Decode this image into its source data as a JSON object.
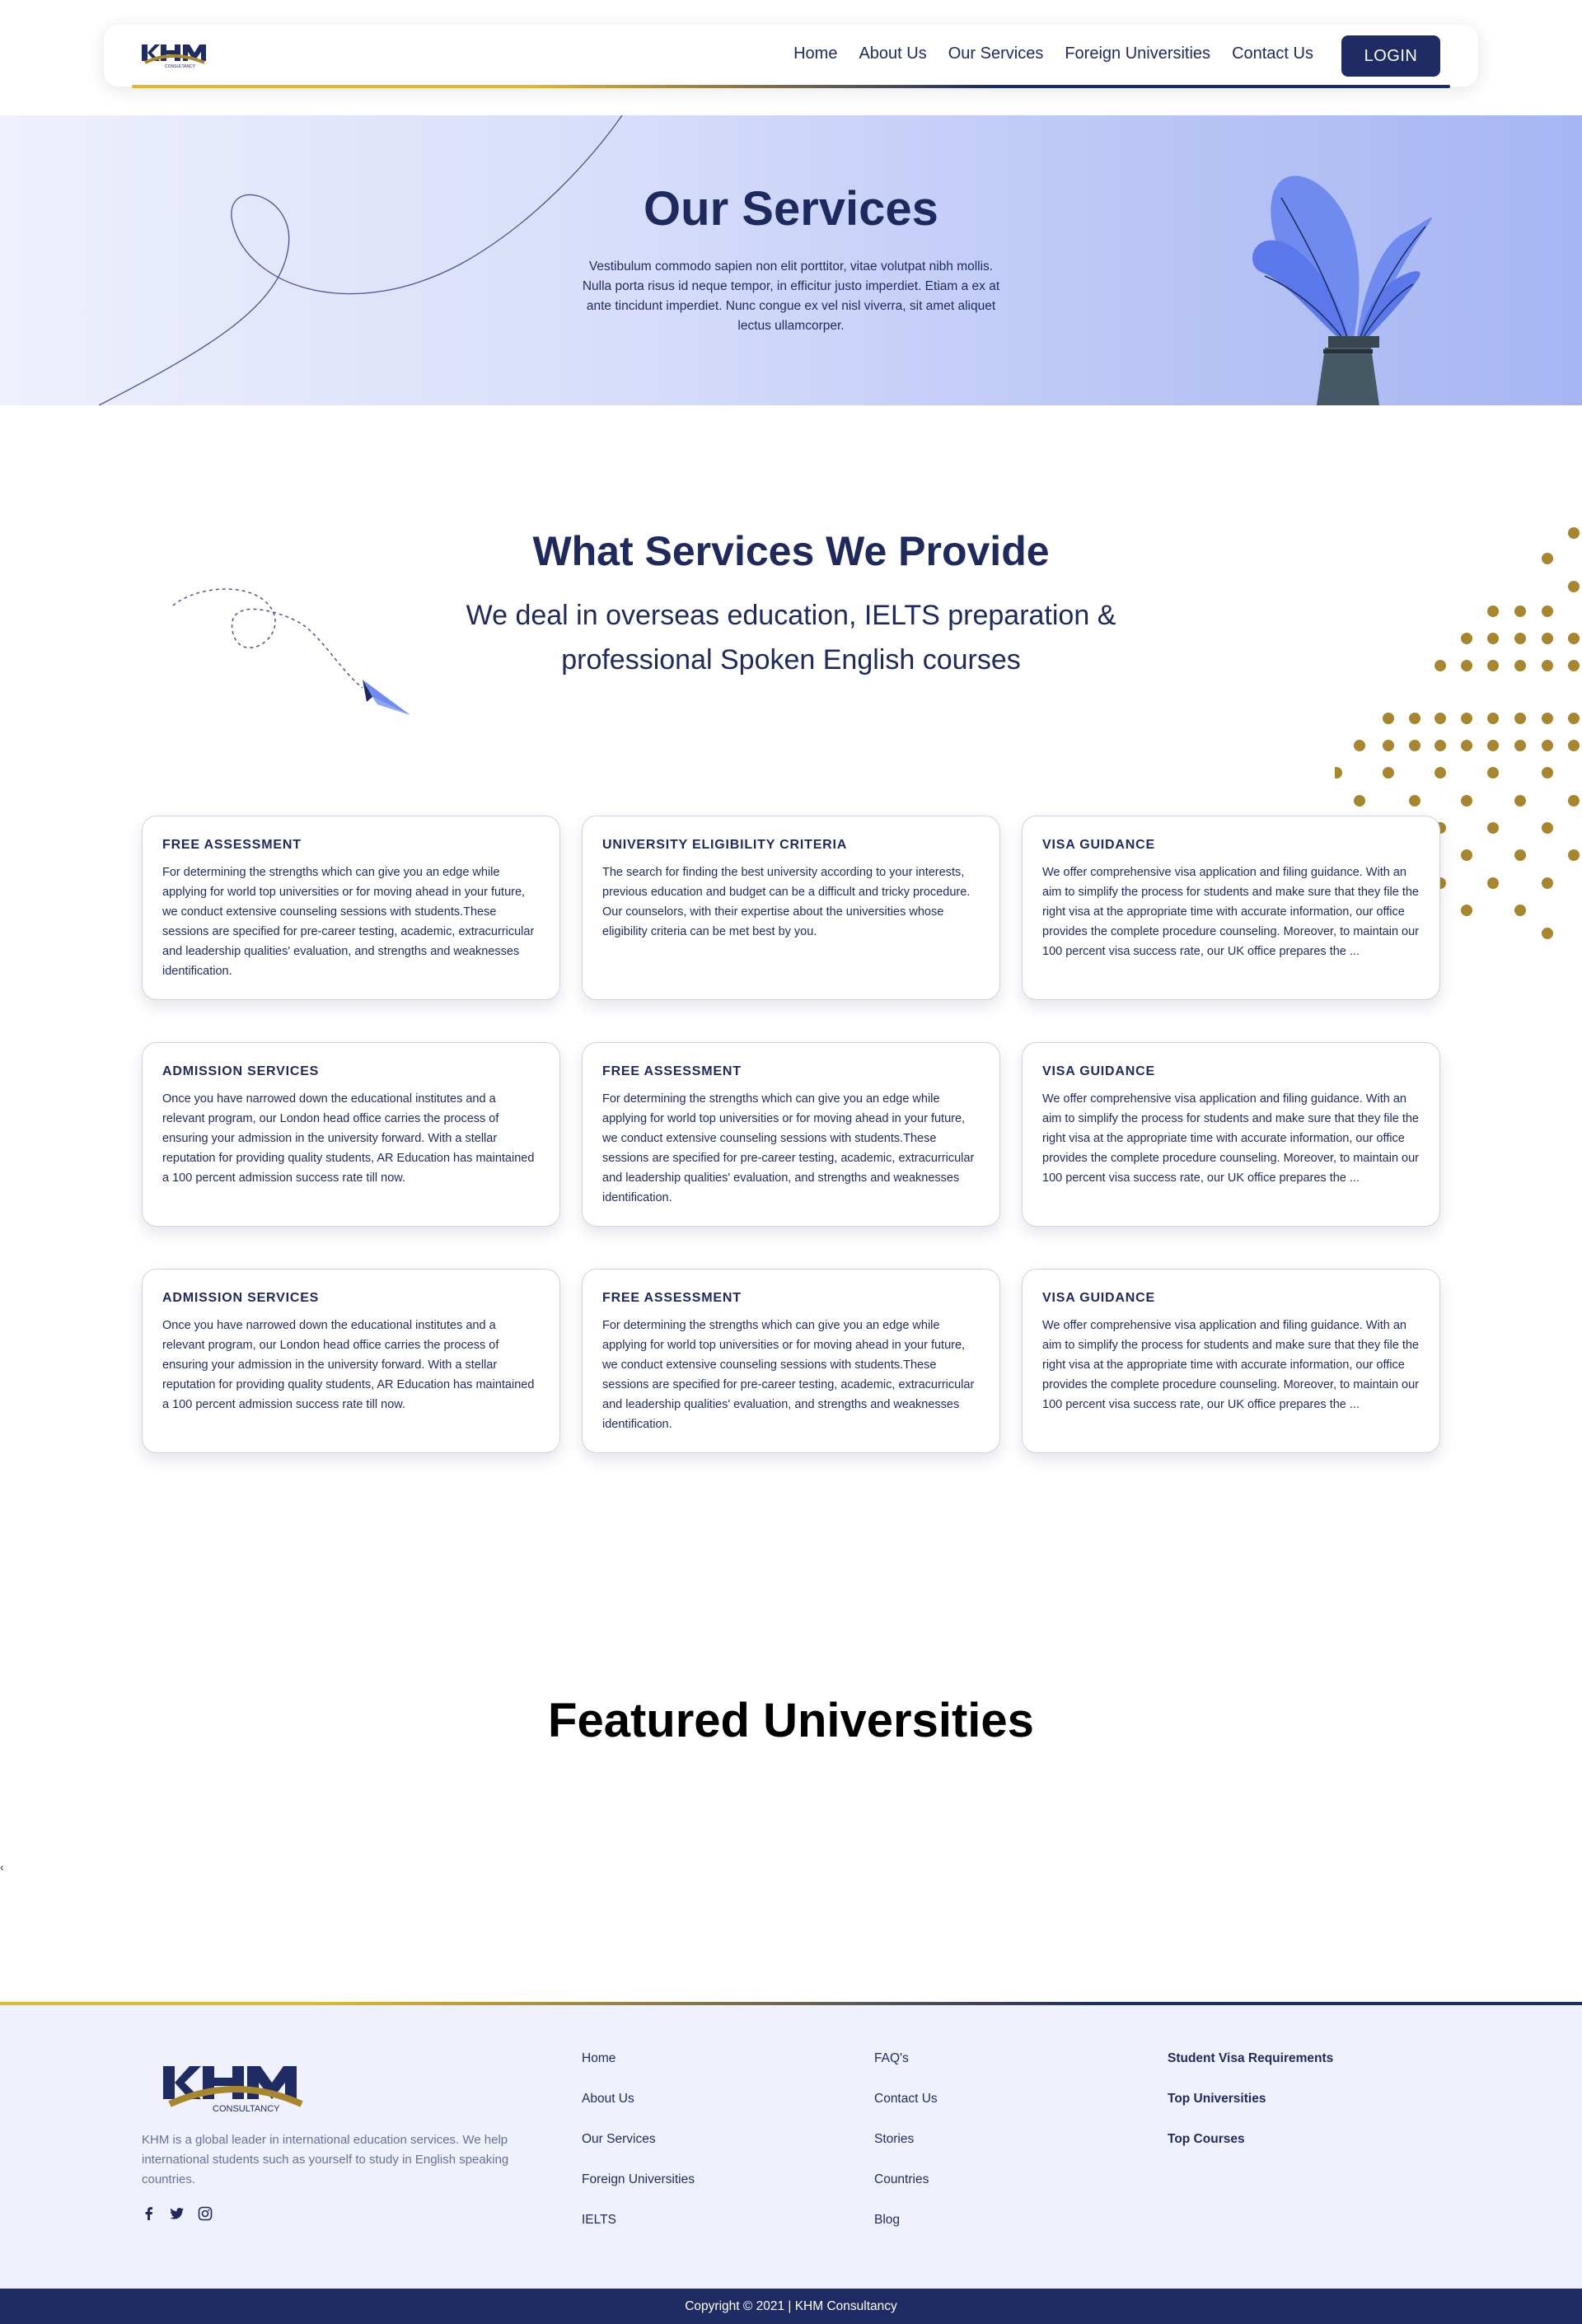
{
  "nav": {
    "links": [
      "Home",
      "About Us",
      "Our Services",
      "Foreign Universities",
      "Contact Us"
    ],
    "login_label": "LOGIN"
  },
  "hero": {
    "title": "Our Services",
    "text": "Vestibulum commodo sapien non elit porttitor, vitae volutpat nibh mollis. Nulla porta risus id neque tempor, in efficitur justo imperdiet. Etiam a ex at ante tincidunt imperdiet. Nunc congue ex vel nisl viverra, sit amet aliquet lectus ullamcorper."
  },
  "services": {
    "title": "What Services We Provide",
    "subtitle": "We deal in overseas education, IELTS preparation & professional Spoken English courses",
    "cards": [
      {
        "title": "FREE ASSESSMENT",
        "body": "For determining the strengths which can give you an edge while applying for world top universities or for moving ahead in your future, we conduct extensive counseling sessions with students.These sessions are specified for pre-career testing, academic, extracurricular and leadership qualities' evaluation, and strengths and weaknesses identification."
      },
      {
        "title": "UNIVERSITY ELIGIBILITY CRITERIA",
        "body": "The search for finding the best university according to your interests, previous education and budget can be a difficult and tricky procedure. Our counselors, with their expertise about the universities whose eligibility criteria can be met best by you."
      },
      {
        "title": "VISA GUIDANCE",
        "body": "We offer comprehensive visa application and filing guidance. With an aim to simplify the process for students and make sure that they file the right visa at the appropriate time with accurate information, our office provides the complete procedure counseling. Moreover, to maintain our 100 percent visa success rate, our UK office prepares the ..."
      },
      {
        "title": "ADMISSION SERVICES",
        "body": "Once you have narrowed down the educational institutes and a relevant program, our London head office carries the process of ensuring your admission in the university forward. With a stellar reputation for providing quality students, AR Education has maintained a 100 percent admission success rate till now."
      },
      {
        "title": "FREE ASSESSMENT",
        "body": "For determining the strengths which can give you an edge while applying for world top universities or for moving ahead in your future, we conduct extensive counseling sessions with students.These sessions are specified for pre-career testing, academic, extracurricular and leadership qualities' evaluation, and strengths and weaknesses identification."
      },
      {
        "title": "VISA GUIDANCE",
        "body": "We offer comprehensive visa application and filing guidance. With an aim to simplify the process for students and make sure that they file the right visa at the appropriate time with accurate information, our office provides the complete procedure counseling. Moreover, to maintain our 100 percent visa success rate, our UK office prepares the ..."
      },
      {
        "title": "ADMISSION SERVICES",
        "body": "Once you have narrowed down the educational institutes and a relevant program, our London head office carries the process of ensuring your admission in the university forward. With a stellar reputation for providing quality students, AR Education has maintained a 100 percent admission success rate till now."
      },
      {
        "title": "FREE ASSESSMENT",
        "body": "For determining the strengths which can give you an edge while applying for world top universities or for moving ahead in your future, we conduct extensive counseling sessions with students.These sessions are specified for pre-career testing, academic, extracurricular and leadership qualities' evaluation, and strengths and weaknesses identification."
      },
      {
        "title": "VISA GUIDANCE",
        "body": "We offer comprehensive visa application and filing guidance. With an aim to simplify the process for students and make sure that they file the right visa at the appropriate time with accurate information, our office provides the complete procedure counseling. Moreover, to maintain our 100 percent visa success rate, our UK office prepares the ..."
      }
    ]
  },
  "featured": {
    "title": "Featured Universities"
  },
  "footer": {
    "logo_text": "KHM",
    "logo_subtext": "CONSULTANCY",
    "description": "KHM is a global leader in international education services. We help international students such as yourself to study in English speaking countries.",
    "social_icons": [
      "facebook-icon",
      "twitter-icon",
      "instagram-icon"
    ],
    "col1": [
      "Home",
      "About Us",
      "Our Services",
      "Foreign Universities",
      "IELTS"
    ],
    "col2": [
      "FAQ's",
      "Contact Us",
      "Stories",
      "Countries",
      "Blog"
    ],
    "col3": [
      "Student Visa Requirements",
      "Top Universities",
      "Top Courses"
    ],
    "copyright": "Copyright © 2021 | KHM Consultancy"
  },
  "colors": {
    "primary": "#1f2c63",
    "accent_gold": "#e5b72c",
    "dot_gold": "#a8862e",
    "plant_blue": "#6f8bf0"
  }
}
